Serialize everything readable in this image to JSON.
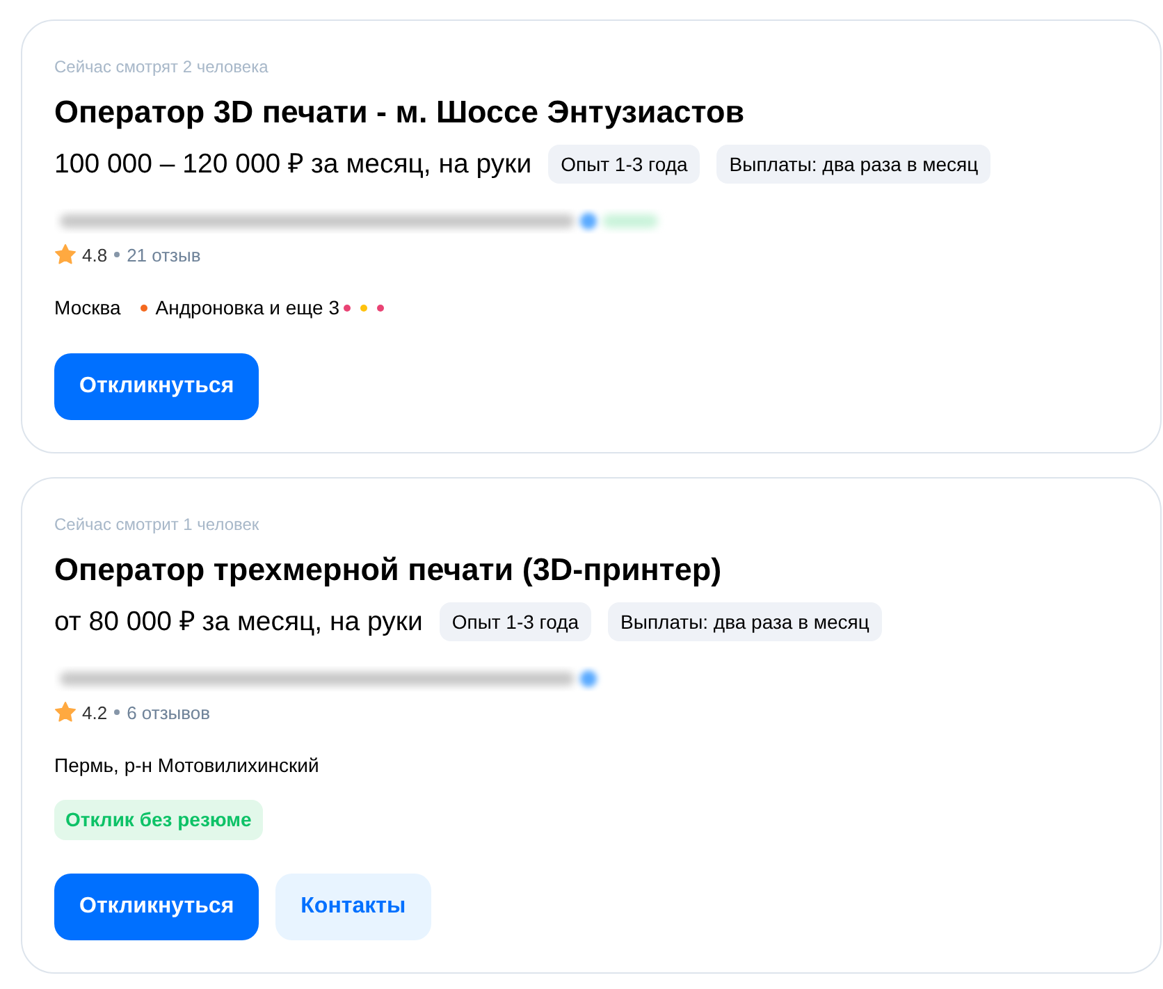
{
  "vacancies": [
    {
      "viewers": "Сейчас смотрят 2 человека",
      "title": "Оператор 3D печати - м. Шоссе Энтузиастов",
      "salary": "100 000 – 120 000 ₽ за месяц, на руки",
      "tags": [
        "Опыт 1-3 года",
        "Выплаты: два раза в месяц"
      ],
      "employer": {
        "verified": true,
        "badge": true
      },
      "rating": {
        "score": "4.8",
        "reviews": "21 отзыв"
      },
      "location": {
        "city": "Москва",
        "metro": [
          {
            "name": "Андроновка и еще 3",
            "color": "#f4691f"
          }
        ],
        "more_lines": [
          {
            "color": "#e94374"
          },
          {
            "color": "#ffc20e"
          },
          {
            "color": "#e94374"
          }
        ]
      },
      "buttons": [
        {
          "label": "Откликнуться",
          "kind": "respond"
        }
      ]
    },
    {
      "viewers": "Сейчас смотрит 1 человек",
      "title": "Оператор трехмерной печати (3D-принтер)",
      "salary": "от 80 000 ₽ за месяц, на руки",
      "tags": [
        "Опыт 1-3 года",
        "Выплаты: два раза в месяц"
      ],
      "employer": {
        "verified": true,
        "badge": false
      },
      "rating": {
        "score": "4.2",
        "reviews": "6 отзывов"
      },
      "location": {
        "city": "Пермь, р-н Мотовилихинский"
      },
      "badges": [
        {
          "label": "Отклик без резюме",
          "kind": "success"
        }
      ],
      "buttons": [
        {
          "label": "Откликнуться",
          "kind": "respond"
        },
        {
          "label": "Контакты",
          "kind": "contacts"
        }
      ]
    }
  ]
}
